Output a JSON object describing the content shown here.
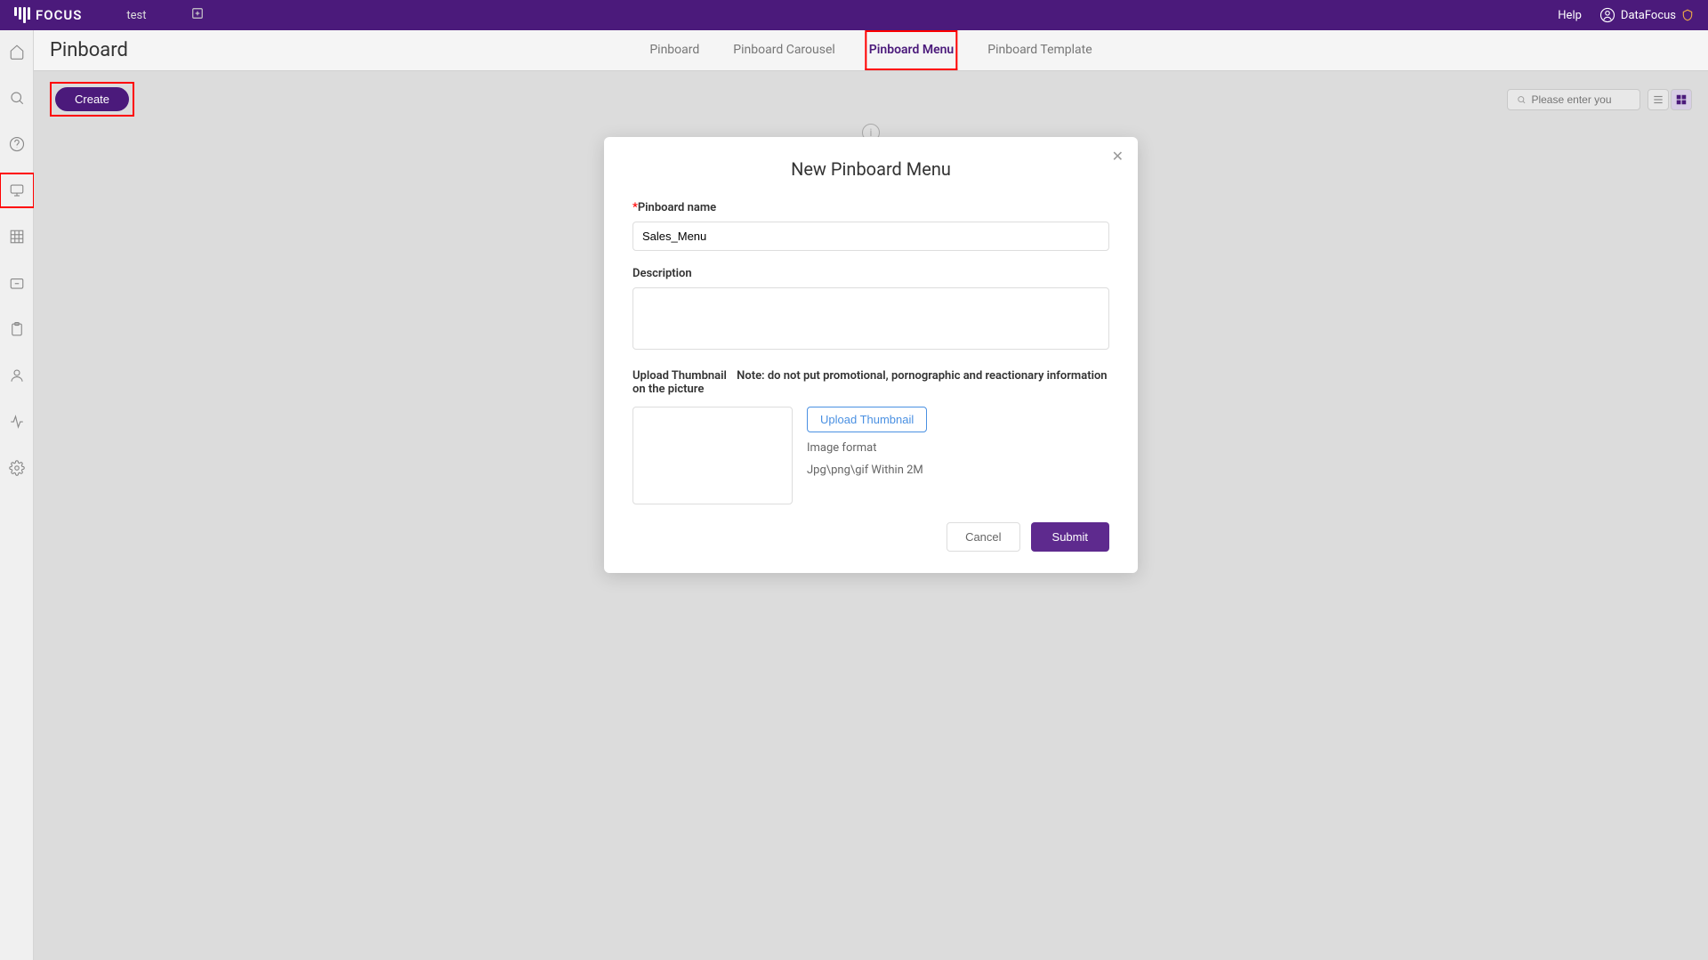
{
  "header": {
    "logo_text": "FOCUS",
    "workspace": "test",
    "help_label": "Help",
    "username": "DataFocus"
  },
  "page": {
    "title": "Pinboard",
    "tabs": [
      {
        "label": "Pinboard"
      },
      {
        "label": "Pinboard Carousel"
      },
      {
        "label": "Pinboard Menu"
      },
      {
        "label": "Pinboard Template"
      }
    ],
    "create_label": "Create",
    "search_placeholder": "Please enter you"
  },
  "modal": {
    "title": "New Pinboard Menu",
    "name_label": "Pinboard name",
    "name_value": "Sales_Menu",
    "description_label": "Description",
    "description_value": "",
    "upload_label": "Upload Thumbnail",
    "upload_note": "Note: do not put promotional, pornographic and reactionary information on the picture",
    "upload_button": "Upload Thumbnail",
    "image_format_label": "Image format",
    "image_format_hint": "Jpg\\png\\gif Within 2M",
    "cancel": "Cancel",
    "submit": "Submit"
  }
}
